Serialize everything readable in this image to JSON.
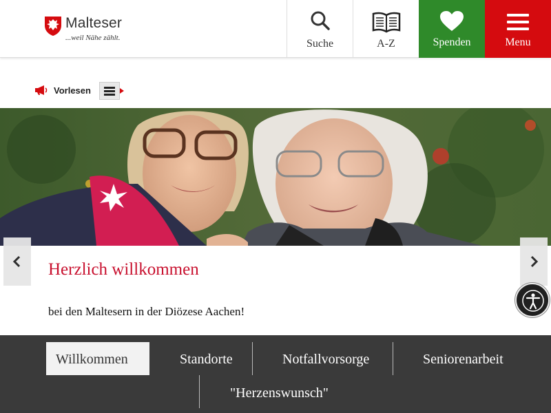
{
  "header": {
    "brand": "Malteser",
    "tagline": "...weil Nähe zählt.",
    "nav": [
      {
        "label": "Suche",
        "icon": "search-icon"
      },
      {
        "label": "A-Z",
        "icon": "book-icon"
      },
      {
        "label": "Spenden",
        "icon": "heart-icon"
      },
      {
        "label": "Menu",
        "icon": "hamburger-icon"
      }
    ],
    "colors": {
      "spenden": "#2f8a2a",
      "menu": "#d50b0f"
    }
  },
  "readaloud": {
    "label": "Vorlesen"
  },
  "hero": {
    "title": "Herzlich willkommen",
    "subtitle": "bei den Maltesern in der Diözese Aachen!"
  },
  "tabs": [
    {
      "label": "Willkommen",
      "active": true
    },
    {
      "label": "Standorte",
      "active": false
    },
    {
      "label": "Notfallvorsorge",
      "active": false
    },
    {
      "label": "Seniorenarbeit",
      "active": false
    },
    {
      "label": "\"Herzenswunsch\"",
      "active": false
    }
  ],
  "accent_color": "#c8102e"
}
